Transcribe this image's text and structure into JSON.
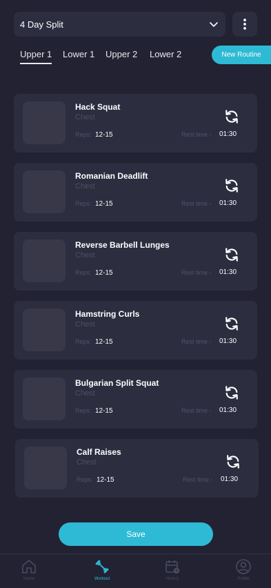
{
  "header": {
    "split_selector": {
      "value": "4 Day Split",
      "icon": "chevron-down-icon"
    },
    "more_icon": "more-vertical-icon"
  },
  "tabs": [
    {
      "label": "Upper 1",
      "active": true
    },
    {
      "label": "Lower 1",
      "active": false
    },
    {
      "label": "Upper 2",
      "active": false
    },
    {
      "label": "Lower 2",
      "active": false
    }
  ],
  "new_routine_label": "New Routine",
  "exercises": [
    {
      "name": "Hack Squat",
      "muscle": "Chest",
      "reps_label": "Reps:",
      "reps": "12-15",
      "rest_label": "Rest time -",
      "rest": "01:30"
    },
    {
      "name": "Romanian Deadlift",
      "muscle": "Chest",
      "reps_label": "Reps:",
      "reps": "12-15",
      "rest_label": "Rest time -",
      "rest": "01:30"
    },
    {
      "name": "Reverse Barbell Lunges",
      "muscle": "Chest",
      "reps_label": "Reps:",
      "reps": "12-15",
      "rest_label": "Rest time -",
      "rest": "01:30"
    },
    {
      "name": "Hamstring Curls",
      "muscle": "Chest",
      "reps_label": "Reps:",
      "reps": "12-15",
      "rest_label": "Rest time -",
      "rest": "01:30"
    },
    {
      "name": "Bulgarian Split Squat",
      "muscle": "Chest",
      "reps_label": "Reps:",
      "reps": "12-15",
      "rest_label": "Rest time -",
      "rest": "01:30"
    },
    {
      "name": "Calf Raises",
      "muscle": "Chest",
      "reps_label": "Reps:",
      "reps": "12-15",
      "rest_label": "Rest time -",
      "rest": "01:30"
    }
  ],
  "save_label": "Save",
  "nav": [
    {
      "label": "Home",
      "icon": "home-icon",
      "active": false
    },
    {
      "label": "Workout",
      "icon": "dumbbell-icon",
      "active": true
    },
    {
      "label": "History",
      "icon": "calendar-clock-icon",
      "active": false
    },
    {
      "label": "Profile",
      "icon": "user-circle-icon",
      "active": false
    }
  ],
  "colors": {
    "background": "#222233",
    "card": "#2d2d40",
    "accent": "#2ebad4",
    "muted": "#52526a"
  }
}
